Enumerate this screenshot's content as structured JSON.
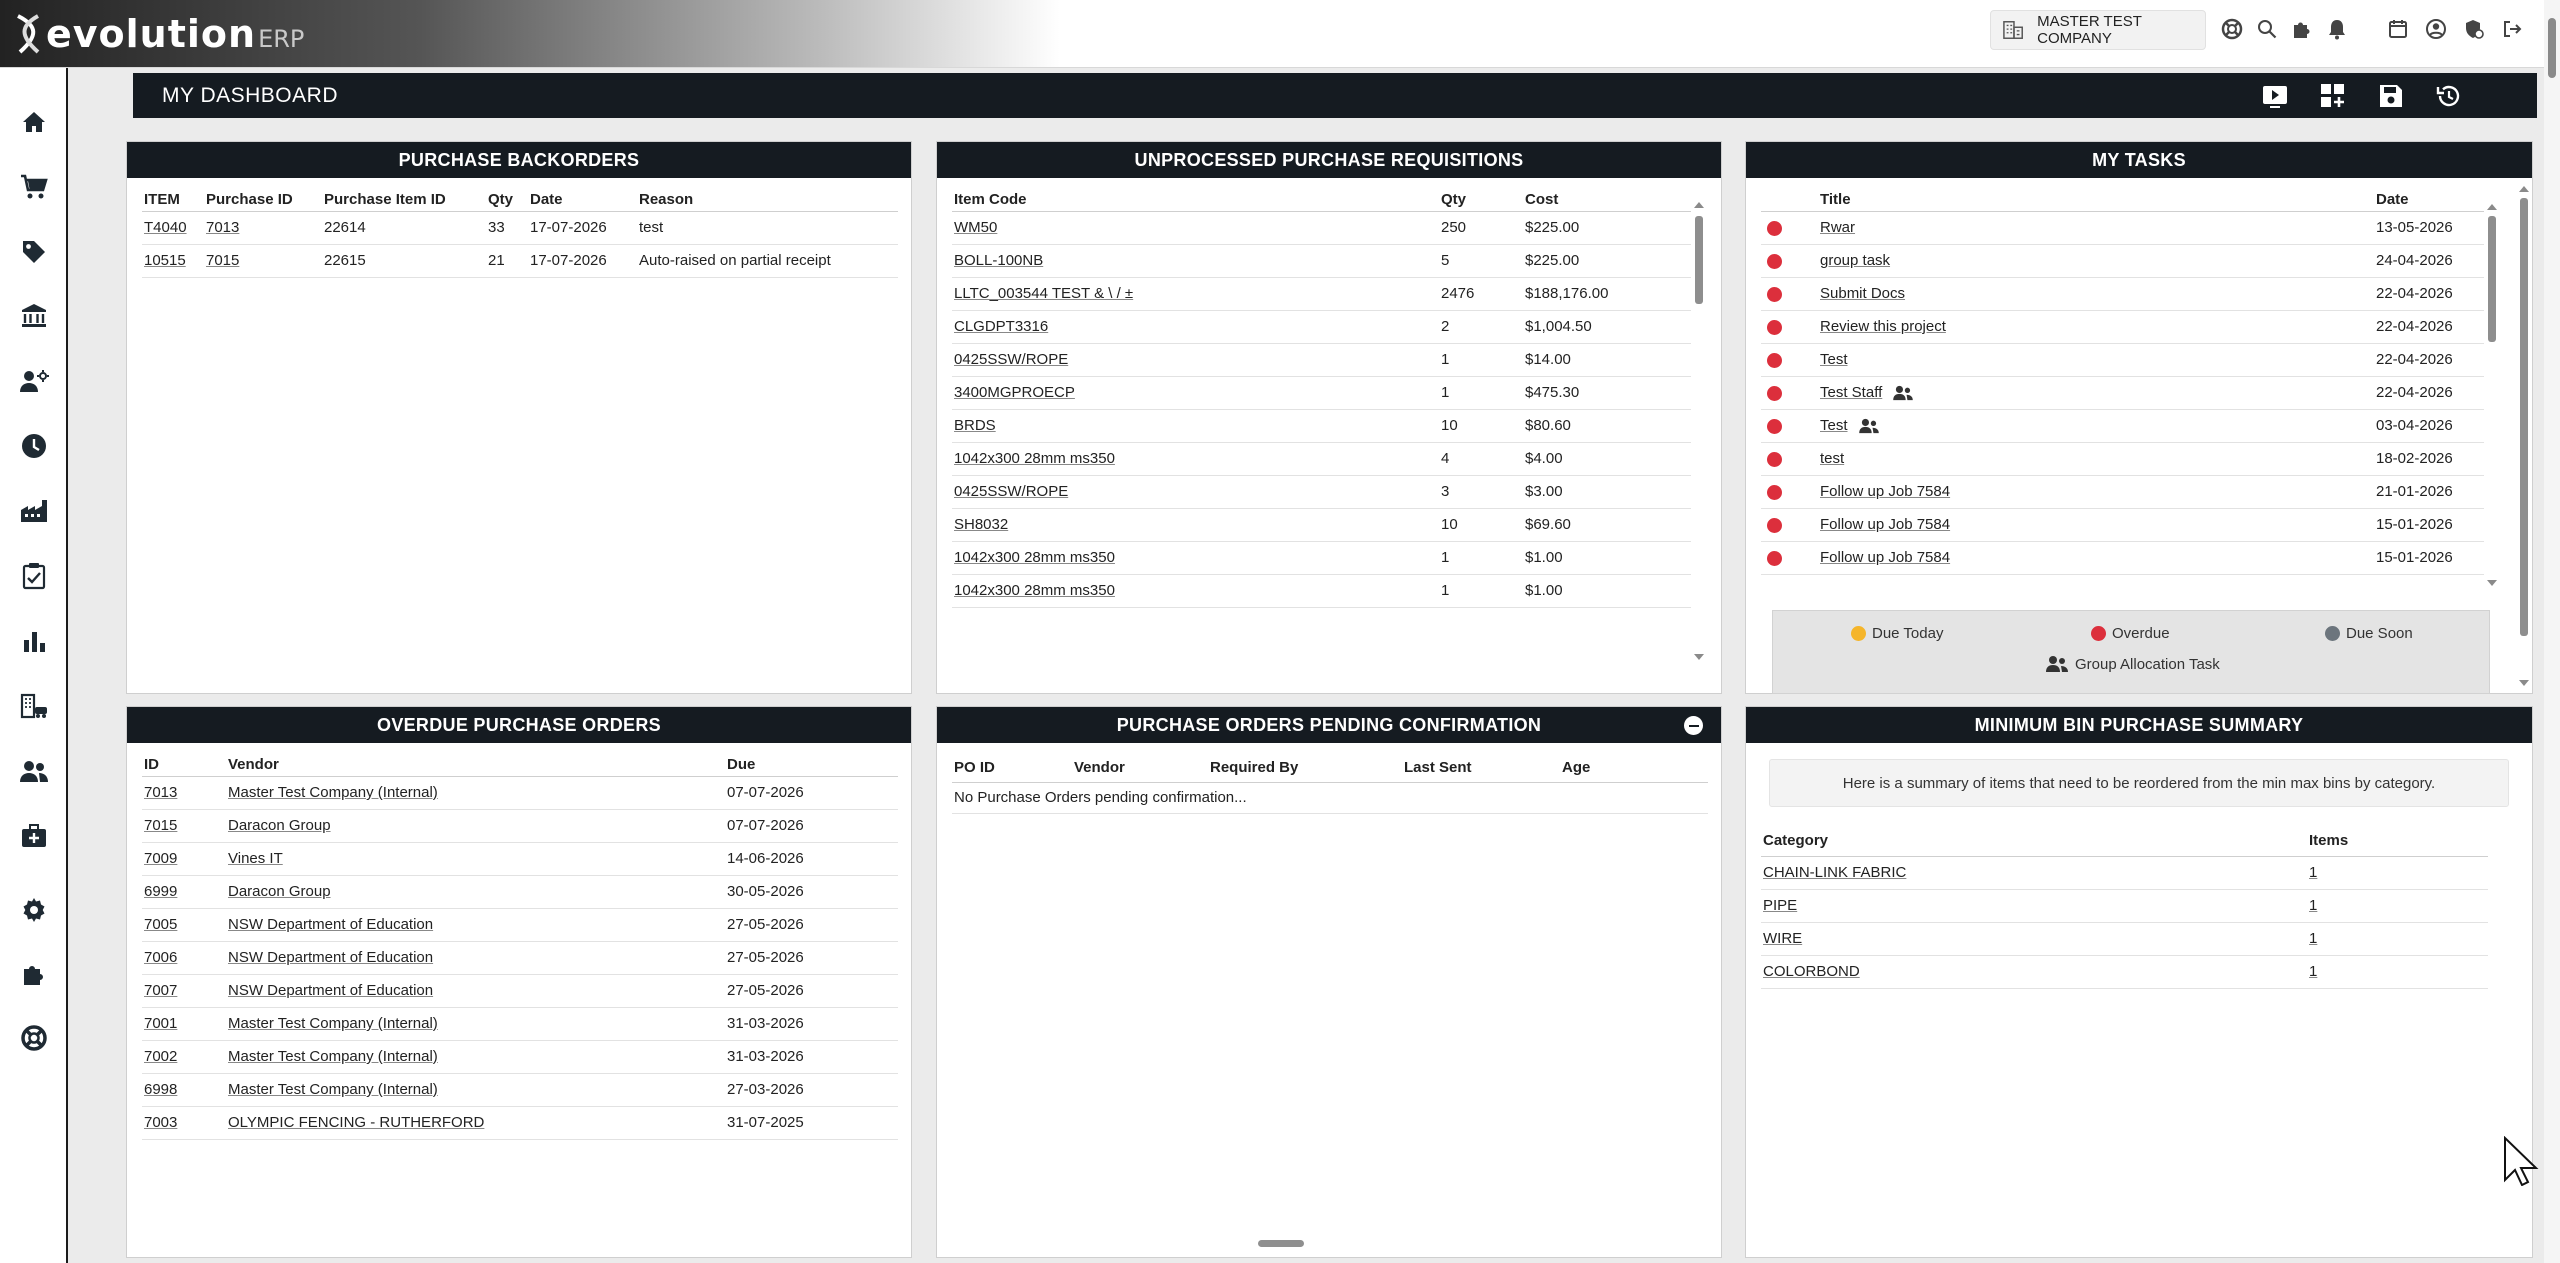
{
  "app": {
    "logo_text": "evolution",
    "logo_sub": "ERP",
    "company": "MASTER TEST COMPANY"
  },
  "icons": {
    "top": [
      "building-icon",
      "support-icon",
      "search-icon",
      "plugin-icon",
      "bell-icon",
      "calendar-icon",
      "user-icon",
      "security-icon",
      "logout-icon"
    ],
    "sidebar": [
      "home-icon",
      "cart-icon",
      "tag-icon",
      "bank-icon",
      "staff-icon",
      "clock-icon",
      "factory-icon",
      "clipboard-check-icon",
      "bar-chart-icon",
      "building-vehicle-icon",
      "people-icon",
      "medical-kit-icon",
      "gear-icon",
      "plugin-icon",
      "support-icon"
    ],
    "header": [
      "play-icon",
      "add-widget-icon",
      "save-icon",
      "history-icon"
    ]
  },
  "dashboard": {
    "title": "MY DASHBOARD"
  },
  "backorders": {
    "title": "PURCHASE BACKORDERS",
    "headers": [
      "ITEM",
      "Purchase ID",
      "Purchase Item ID",
      "Qty",
      "Date",
      "Reason"
    ],
    "rows": [
      [
        "T4040",
        "7013",
        "22614",
        "33",
        "17-07-2026",
        "test"
      ],
      [
        "10515",
        "7015",
        "22615",
        "21",
        "17-07-2026",
        "Auto-raised on partial receipt"
      ]
    ]
  },
  "requisitions": {
    "title": "UNPROCESSED PURCHASE REQUISITIONS",
    "headers": [
      "Item Code",
      "Qty",
      "Cost"
    ],
    "rows": [
      [
        "WM50",
        "250",
        "$225.00"
      ],
      [
        "BOLL-100NB",
        "5",
        "$225.00"
      ],
      [
        "LLTC_003544 TEST & \\ / ±",
        "2476",
        "$188,176.00"
      ],
      [
        "CLGDPT3316",
        "2",
        "$1,004.50"
      ],
      [
        "0425SSW/ROPE",
        "1",
        "$14.00"
      ],
      [
        "3400MGPROECP",
        "1",
        "$475.30"
      ],
      [
        "BRDS",
        "10",
        "$80.60"
      ],
      [
        "1042x300 28mm ms350",
        "4",
        "$4.00"
      ],
      [
        "0425SSW/ROPE",
        "3",
        "$3.00"
      ],
      [
        "SH8032",
        "10",
        "$69.60"
      ],
      [
        "1042x300 28mm ms350",
        "1",
        "$1.00"
      ],
      [
        "1042x300 28mm ms350",
        "1",
        "$1.00"
      ]
    ]
  },
  "tasks": {
    "title": "MY TASKS",
    "headers": [
      "Title",
      "Date"
    ],
    "rows": [
      {
        "title": "Rwar",
        "date": "13-05-2026",
        "group": false
      },
      {
        "title": "group task",
        "date": "24-04-2026",
        "group": false
      },
      {
        "title": "Submit Docs",
        "date": "22-04-2026",
        "group": false
      },
      {
        "title": "Review this project",
        "date": "22-04-2026",
        "group": false
      },
      {
        "title": "Test",
        "date": "22-04-2026",
        "group": false
      },
      {
        "title": "Test Staff",
        "date": "22-04-2026",
        "group": true
      },
      {
        "title": "Test",
        "date": "03-04-2026",
        "group": true
      },
      {
        "title": "test",
        "date": "18-02-2026",
        "group": false
      },
      {
        "title": "Follow up Job 7584",
        "date": "21-01-2026",
        "group": false
      },
      {
        "title": "Follow up Job 7584",
        "date": "15-01-2026",
        "group": false
      },
      {
        "title": "Follow up Job 7584",
        "date": "15-01-2026",
        "group": false
      }
    ],
    "legend": {
      "due_today": "Due Today",
      "overdue": "Overdue",
      "due_soon": "Due Soon",
      "group": "Group Allocation Task"
    },
    "colors": {
      "due_today": "#f5b52a",
      "overdue": "#dc2f3c",
      "due_soon": "#6c757d"
    }
  },
  "overdue": {
    "title": "OVERDUE PURCHASE ORDERS",
    "headers": [
      "ID",
      "Vendor",
      "Due"
    ],
    "rows": [
      [
        "7013",
        "Master Test Company (Internal)",
        "07-07-2026"
      ],
      [
        "7015",
        "Daracon Group",
        "07-07-2026"
      ],
      [
        "7009",
        "Vines IT",
        "14-06-2026"
      ],
      [
        "6999",
        "Daracon Group",
        "30-05-2026"
      ],
      [
        "7005",
        "NSW Department of Education",
        "27-05-2026"
      ],
      [
        "7006",
        "NSW Department of Education",
        "27-05-2026"
      ],
      [
        "7007",
        "NSW Department of Education",
        "27-05-2026"
      ],
      [
        "7001",
        "Master Test Company (Internal)",
        "31-03-2026"
      ],
      [
        "7002",
        "Master Test Company (Internal)",
        "31-03-2026"
      ],
      [
        "6998",
        "Master Test Company (Internal)",
        "27-03-2026"
      ],
      [
        "7003",
        "OLYMPIC FENCING - RUTHERFORD",
        "31-07-2025"
      ]
    ]
  },
  "pending": {
    "title": "PURCHASE ORDERS PENDING CONFIRMATION",
    "headers": [
      "PO ID",
      "Vendor",
      "Required By",
      "Last Sent",
      "Age"
    ],
    "empty": "No Purchase Orders pending confirmation..."
  },
  "minbin": {
    "title": "MINIMUM BIN PURCHASE SUMMARY",
    "note": "Here is a summary of items that need to be reordered from the min max bins by category.",
    "headers": [
      "Category",
      "Items"
    ],
    "rows": [
      [
        "CHAIN-LINK FABRIC",
        "1"
      ],
      [
        "PIPE",
        "1"
      ],
      [
        "WIRE",
        "1"
      ],
      [
        "COLORBOND",
        "1"
      ]
    ]
  }
}
